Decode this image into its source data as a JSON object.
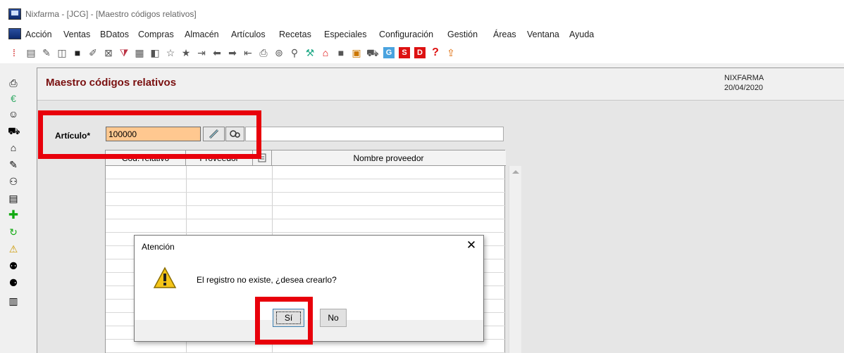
{
  "window": {
    "title": "Nixfarma - [JCG] - [Maestro códigos relativos]"
  },
  "menu": [
    "Acción",
    "Ventas",
    "BDatos",
    "Compras",
    "Almacén",
    "Artículos",
    "Recetas",
    "Especiales",
    "Configuración",
    "Gestión",
    "Áreas",
    "Ventana",
    "Ayuda"
  ],
  "toolbar": {
    "icons": [
      "list-icon",
      "grid-icon",
      "edit-icon",
      "archive-icon",
      "car-icon",
      "note-icon",
      "close-box-icon",
      "filter-icon",
      "calendar-icon",
      "split-icon",
      "star-outline-icon",
      "star-icon",
      "export-icon",
      "arrow-left-icon",
      "arrow-right-icon",
      "import-icon",
      "printer-icon",
      "search-icon",
      "pin-icon",
      "tools-icon",
      "home-icon",
      "stop-icon",
      "chart-icon",
      "cart-icon",
      "g-icon",
      "s-icon",
      "d-icon",
      "help-icon",
      "upload-icon"
    ],
    "box_letters": {
      "g": "G",
      "s": "S",
      "d": "D",
      "help": "?"
    }
  },
  "sidebar": {
    "icons": [
      "printer-icon",
      "euro-icon",
      "person-icon",
      "cart-icon",
      "factory-icon",
      "pill-icon",
      "people-icon",
      "cash-register-icon",
      "cross-icon",
      "refresh-icon",
      "warning-icon",
      "users-icon",
      "group-icon",
      "barcode-icon"
    ]
  },
  "document": {
    "title": "Maestro códigos relativos",
    "company": "NIXFARMA",
    "date": "20/04/2020"
  },
  "form": {
    "articulo_label": "Artículo*",
    "articulo_value": "100000"
  },
  "grid": {
    "columns": [
      "Cód. relativo",
      "Proveedor",
      "Nombre proveedor"
    ]
  },
  "dialog": {
    "title": "Atención",
    "message": "El registro no existe, ¿desea crearlo?",
    "yes_label": "Sí",
    "no_label": "No"
  },
  "colors": {
    "highlight": "#e8000b",
    "doc_title": "#7a1010",
    "input_bg": "#ffc890"
  }
}
